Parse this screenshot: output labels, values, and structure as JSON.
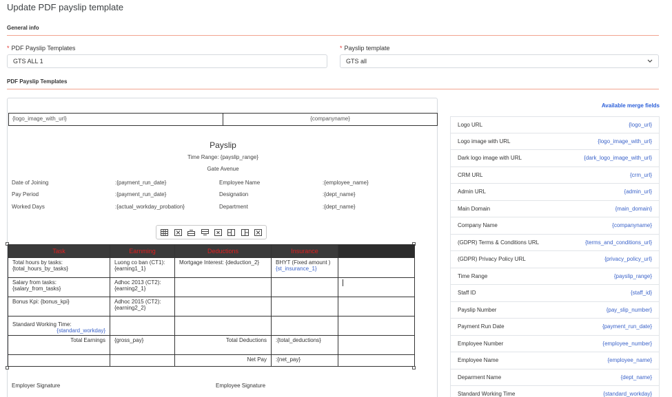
{
  "page": {
    "title": "Update PDF payslip template"
  },
  "general_info": {
    "section_label": "General info",
    "templates_label": "PDF Payslip Templates",
    "templates_value": "GTS ALL 1",
    "payslip_template_label": "Payslip template",
    "payslip_template_value": "GTS all"
  },
  "pdf_section": {
    "section_label": "PDF Payslip Templates"
  },
  "editor": {
    "header_left": "{logo_image_with_url}",
    "header_right": "{companyname}",
    "title": "Payslip",
    "time_range": "Time Range: {payslip_range}",
    "address": "Gate Avenue",
    "info_rows": [
      {
        "label1": "Date of Joining",
        "value1": ":{payment_run_date}",
        "label2": "Employee Name",
        "value2": ":{employee_name}"
      },
      {
        "label1": "Pay Period",
        "value1": ":{payment_run_date}",
        "label2": "Designation",
        "value2": ":{dept_name}"
      },
      {
        "label1": "Worked Days",
        "value1": ":{actual_workday_probation}",
        "label2": "Department",
        "value2": ":{dept_name}"
      }
    ],
    "table": {
      "headers": [
        "Task",
        "Earnming",
        "Deductions",
        "Insurance",
        ""
      ],
      "r1": {
        "c1": "Total hours by tasks: {total_hours_by_tasks}",
        "c2": "Luong co ban (CT1): {earning1_1}",
        "c3": "Mortgage Interest: {deduction_2}",
        "c4a": "BHYT (Fixed amount )",
        "c4b": "{st_insurance_1}"
      },
      "r2": {
        "c1": "Salary from tasks: {salary_from_tasks}",
        "c2": "Adhoc 2013 (CT2): {earning2_1}"
      },
      "r3": {
        "c1": "Bonus Kpi: {bonus_kpi}",
        "c2": "Adhoc 2015 (CT2): {earning2_2}"
      },
      "r4": {
        "c1a": "Standard Working Time:",
        "c1b": "{standard_workday}"
      },
      "r5": {
        "c1": "Total Earnings",
        "c2": "{gross_pay}",
        "c3": "Total Deductions",
        "c4": ":{total_deductions}"
      },
      "r6": {
        "c3": "Net Pay",
        "c4": ":{net_pay}"
      }
    },
    "employer_signature": "Employer Signature",
    "employee_signature": "Employee Signature"
  },
  "merge_fields": {
    "link_label": "Available merge fields",
    "items": [
      {
        "label": "Logo URL",
        "value": "{logo_url}"
      },
      {
        "label": "Logo image with URL",
        "value": "{logo_image_with_url}"
      },
      {
        "label": "Dark logo image with URL",
        "value": "{dark_logo_image_with_url}"
      },
      {
        "label": "CRM URL",
        "value": "{crm_url}"
      },
      {
        "label": "Admin URL",
        "value": "{admin_url}"
      },
      {
        "label": "Main Domain",
        "value": "{main_domain}"
      },
      {
        "label": "Company Name",
        "value": "{companyname}"
      },
      {
        "label": "(GDPR) Terms & Conditions URL",
        "value": "{terms_and_conditions_url}"
      },
      {
        "label": "(GDPR) Privacy Policy URL",
        "value": "{privacy_policy_url}"
      },
      {
        "label": "Time Range",
        "value": "{payslip_range}"
      },
      {
        "label": "Staff ID",
        "value": "{staff_id}"
      },
      {
        "label": "Payslip Number",
        "value": "{pay_slip_number}"
      },
      {
        "label": "Payment Run Date",
        "value": "{payment_run_date}"
      },
      {
        "label": "Employee Number",
        "value": "{employee_number}"
      },
      {
        "label": "Employee Name",
        "value": "{employee_name}"
      },
      {
        "label": "Deparment Name",
        "value": "{dept_name}"
      },
      {
        "label": "Standard Working Time",
        "value": "{standard_workday}"
      }
    ]
  },
  "colors": {
    "accent_line": "#f2a48f",
    "link": "#2b5fd9",
    "merge_value": "#3b63c9",
    "table_header_text": "#e02020",
    "table_header_bg": "#3a3a3a"
  },
  "icons": [
    "table-icon",
    "delete-table-icon",
    "insert-row-above-icon",
    "insert-row-below-icon",
    "delete-row-icon",
    "insert-col-left-icon",
    "insert-col-right-icon",
    "delete-col-icon",
    "chevron-down-icon"
  ]
}
